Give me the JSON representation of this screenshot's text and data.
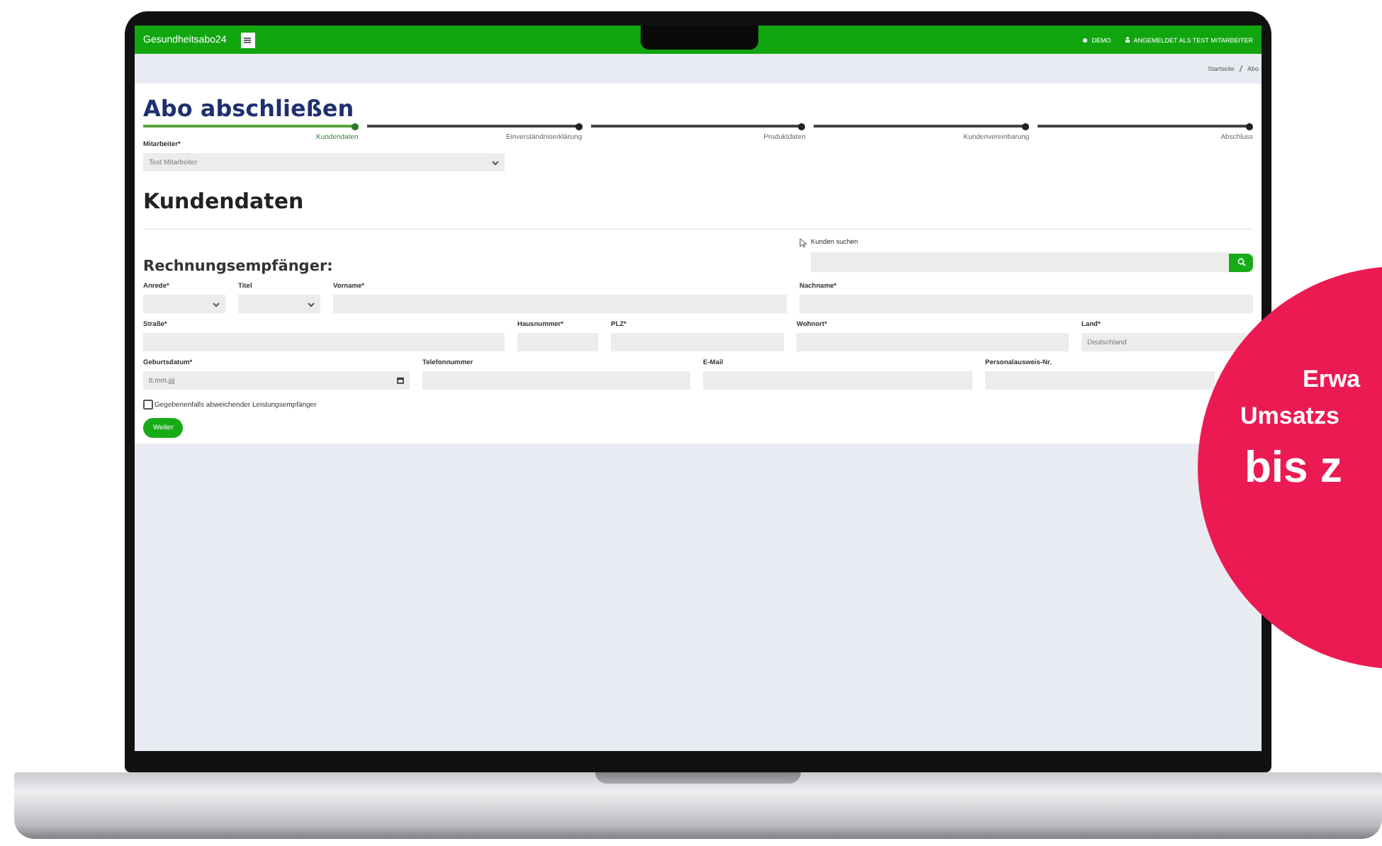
{
  "header": {
    "brand": "Gesundheitsabo24",
    "environment": "DEMO",
    "user": "ANGEMELDET ALS TEST MITARBEITER"
  },
  "breadcrumb": [
    "Startseite",
    "Abo"
  ],
  "page_title": "Abo abschließen",
  "steps": [
    {
      "label": "Kundendaten",
      "done": true
    },
    {
      "label": "Einverständniserklärung",
      "done": false
    },
    {
      "label": "Produktdaten",
      "done": false
    },
    {
      "label": "Kundenvereinbarung",
      "done": false
    },
    {
      "label": "Abschluss",
      "done": false
    }
  ],
  "employee": {
    "label": "Mitarbeiter*",
    "value": "Test Mitarbeiter"
  },
  "section_title": "Kundendaten",
  "billing_title": "Rechnungsempfänger:",
  "customer_search": {
    "label": "Kunden suchen"
  },
  "form_rows": [
    [
      {
        "label": "Anrede*",
        "kind": "select"
      },
      {
        "label": "Titel",
        "kind": "select"
      },
      {
        "label": "Vorname*",
        "kind": "text"
      },
      {
        "label": "Nachname*",
        "kind": "text"
      }
    ],
    [
      {
        "label": "Straße*",
        "kind": "text"
      },
      {
        "label": "Hausnummer*",
        "kind": "text"
      },
      {
        "label": "PLZ*",
        "kind": "text"
      },
      {
        "label": "Wohnort*",
        "kind": "text"
      },
      {
        "label": "Land*",
        "kind": "text",
        "placeholder": "Deutschland"
      }
    ],
    [
      {
        "label": "Geburtsdatum*",
        "kind": "date",
        "placeholder": "tt.mm.jjjj"
      },
      {
        "label": "Telefonnummer",
        "kind": "text"
      },
      {
        "label": "E-Mail",
        "kind": "text"
      },
      {
        "label": "Personalausweis-Nr.",
        "kind": "text"
      }
    ]
  ],
  "other_recipient": {
    "label": "Gegebenenfalls abweichender Leistungsempfänger",
    "checked": false
  },
  "next_button": "Weiter",
  "promo": {
    "lines": [
      "Erwa",
      "Umsatzs",
      "bis z"
    ]
  }
}
